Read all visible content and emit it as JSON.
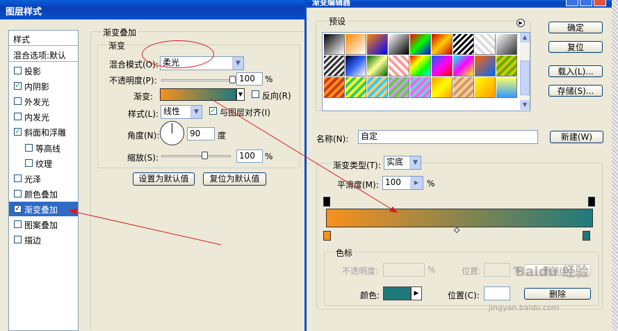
{
  "layer_style": {
    "title": "图层样式",
    "styles_header": "样式",
    "blend_options": "混合选项:默认",
    "styles": [
      {
        "label": "投影",
        "checked": false
      },
      {
        "label": "内阴影",
        "checked": true
      },
      {
        "label": "外发光",
        "checked": false
      },
      {
        "label": "内发光",
        "checked": false
      },
      {
        "label": "斜面和浮雕",
        "checked": true
      },
      {
        "label": "等高线",
        "checked": false
      },
      {
        "label": "纹理",
        "checked": false
      },
      {
        "label": "光泽",
        "checked": false
      },
      {
        "label": "颜色叠加",
        "checked": false
      },
      {
        "label": "渐变叠加",
        "checked": true
      },
      {
        "label": "图案叠加",
        "checked": false
      },
      {
        "label": "描边",
        "checked": false
      }
    ],
    "section_title": "渐变叠加",
    "group_title": "渐变",
    "blend_mode_label": "混合模式(O):",
    "blend_mode_value": "柔光",
    "opacity_label": "不透明度(P):",
    "opacity_value": "100",
    "opacity_unit": "%",
    "opacity_level": 1.0,
    "gradient_label": "渐变:",
    "reverse_label": "反向(R)",
    "reverse_checked": false,
    "style_label": "样式(L):",
    "style_value": "线性",
    "align_label": "与图层对齐(I)",
    "align_checked": true,
    "angle_label": "角度(N):",
    "angle_value": "90",
    "angle_unit": "度",
    "scale_label": "缩放(S):",
    "scale_value": "100",
    "scale_unit": "%",
    "scale_level": 0.5,
    "set_default_button": "设置为默认值",
    "reset_default_button": "复位为默认值"
  },
  "gradient_editor": {
    "title": "渐变编辑器",
    "presets_label": "预设",
    "ok_button": "确定",
    "reset_button": "复位",
    "load_button": "载入(L)...",
    "save_button": "存储(S)...",
    "name_label": "名称(N):",
    "name_value": "自定",
    "new_button": "新建(W)",
    "type_label": "渐变类型(T):",
    "type_value": "实底",
    "smooth_label": "平滑度(M):",
    "smooth_value": "100",
    "smooth_unit": "%",
    "stops_group": "色标",
    "stop_opacity_label": "不透明度:",
    "stop_opacity_unit": "%",
    "stop_position_label": "位置:",
    "stop_position_unit": "%",
    "delete_button": "删除(D)",
    "color_label": "颜色:",
    "color_position_label": "位置(C):",
    "color_delete_button": "删除",
    "watermark": "Baidu 经验",
    "watermark_url": "jingyan.baidu.com"
  },
  "colors": {
    "start": "#f7901e",
    "end": "#1f7a7c",
    "xp_blue": "#0a4fc8",
    "highlight": "#316ac5"
  }
}
